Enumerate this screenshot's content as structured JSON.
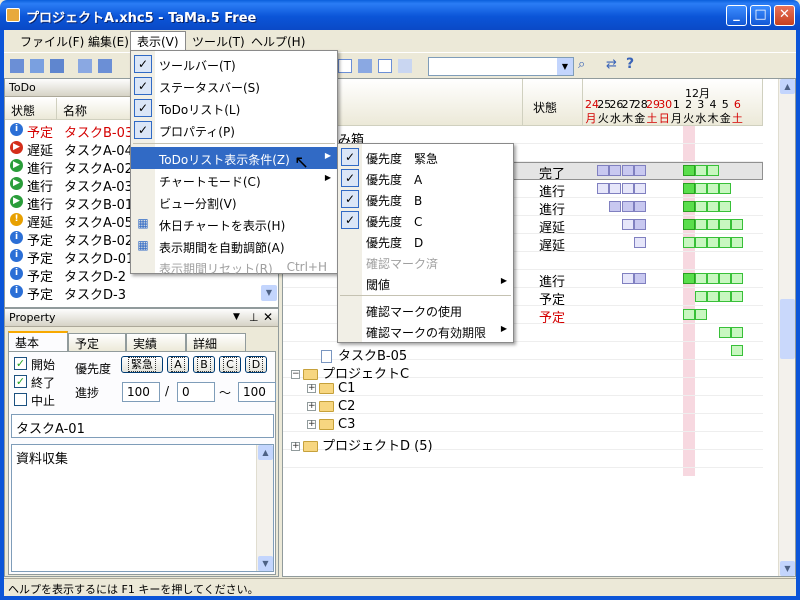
{
  "window": {
    "title": "プロジェクトA.xhc5 - TaMa.5 Free"
  },
  "menubar": [
    "ファイル(F)",
    "編集(E)",
    "表示(V)",
    "ツール(T)",
    "ヘルプ(H)"
  ],
  "todo": {
    "title": "ToDo",
    "col_status": "状態",
    "col_name": "名称",
    "rows": [
      {
        "status": "予定",
        "name": "タスクB-03"
      },
      {
        "status": "遅延",
        "name": "タスクA-04"
      },
      {
        "status": "進行",
        "name": "タスクA-02"
      },
      {
        "status": "進行",
        "name": "タスクA-03"
      },
      {
        "status": "進行",
        "name": "タスクB-01"
      },
      {
        "status": "遅延",
        "name": "タスクA-05"
      },
      {
        "status": "予定",
        "name": "タスクB-02"
      },
      {
        "status": "予定",
        "name": "タスクD-01"
      },
      {
        "status": "予定",
        "name": "タスクD-2"
      },
      {
        "status": "予定",
        "name": "タスクD-3"
      }
    ]
  },
  "property": {
    "title": "Property",
    "tabs": [
      "基本",
      "予定",
      "実績",
      "詳細"
    ],
    "chk_start": "開始",
    "chk_end": "終了",
    "chk_stop": "中止",
    "priority_label": "優先度",
    "priority_buttons": [
      "緊急",
      "A",
      "B",
      "C",
      "D"
    ],
    "progress_label": "進捗",
    "progress_value": "100",
    "progress_sep": "/",
    "progress_from": "0",
    "progress_tilde": "～",
    "progress_to": "100",
    "task_name": "タスクA-01",
    "memo": "資料収集"
  },
  "chart": {
    "header_status": "状態",
    "month_label": "12月",
    "days": [
      {
        "d": "24",
        "w": "月",
        "red": true
      },
      {
        "d": "25",
        "w": "火",
        "red": false
      },
      {
        "d": "26",
        "w": "水",
        "red": false
      },
      {
        "d": "27",
        "w": "木",
        "red": false
      },
      {
        "d": "28",
        "w": "金",
        "red": false
      },
      {
        "d": "29",
        "w": "土",
        "red": true
      },
      {
        "d": "30",
        "w": "日",
        "red": true
      },
      {
        "d": "1",
        "w": "月",
        "red": false
      },
      {
        "d": "2",
        "w": "火",
        "red": false
      },
      {
        "d": "3",
        "w": "水",
        "red": false
      },
      {
        "d": "4",
        "w": "木",
        "red": false
      },
      {
        "d": "5",
        "w": "金",
        "red": false
      },
      {
        "d": "6",
        "w": "土",
        "red": true
      }
    ],
    "tree_top": "み箱",
    "statuses": [
      "完了",
      "進行",
      "進行",
      "遅延",
      "遅延",
      "進行",
      "予定",
      "予定"
    ],
    "task_b05": "タスクB-05",
    "projects": [
      "プロジェクトC",
      "C1",
      "C2",
      "C3",
      "プロジェクトD (5)"
    ]
  },
  "view_menu": {
    "items": [
      {
        "label": "ツールバー(T)",
        "checked": true
      },
      {
        "label": "ステータスバー(S)",
        "checked": true
      },
      {
        "label": "ToDoリスト(L)",
        "checked": true
      },
      {
        "label": "プロパティ(P)",
        "checked": true
      },
      {
        "label": "ToDoリスト表示条件(Z)"
      },
      {
        "label": "チャートモード(C)"
      },
      {
        "label": "ビュー分割(V)"
      },
      {
        "label": "休日チャートを表示(H)"
      },
      {
        "label": "表示期間を自動調節(A)"
      },
      {
        "label": "表示期間リセット(R)",
        "shortcut": "Ctrl+H"
      }
    ]
  },
  "todo_cond_menu": {
    "items": [
      {
        "label": "優先度　緊急",
        "checked": true
      },
      {
        "label": "優先度　A",
        "checked": true
      },
      {
        "label": "優先度　B",
        "checked": true
      },
      {
        "label": "優先度　C",
        "checked": true
      },
      {
        "label": "優先度　D",
        "checked": false
      },
      {
        "label": "確認マーク済",
        "checked": false
      },
      {
        "label": "閾値"
      },
      {
        "label": "確認マークの使用"
      },
      {
        "label": "確認マークの有効期限"
      }
    ]
  },
  "statusbar": {
    "text": "ヘルプを表示するには F1 キーを押してください。"
  },
  "colors": {
    "accent": "#316ac5",
    "titlebar": "#0b55d8",
    "late": "#d40000"
  }
}
